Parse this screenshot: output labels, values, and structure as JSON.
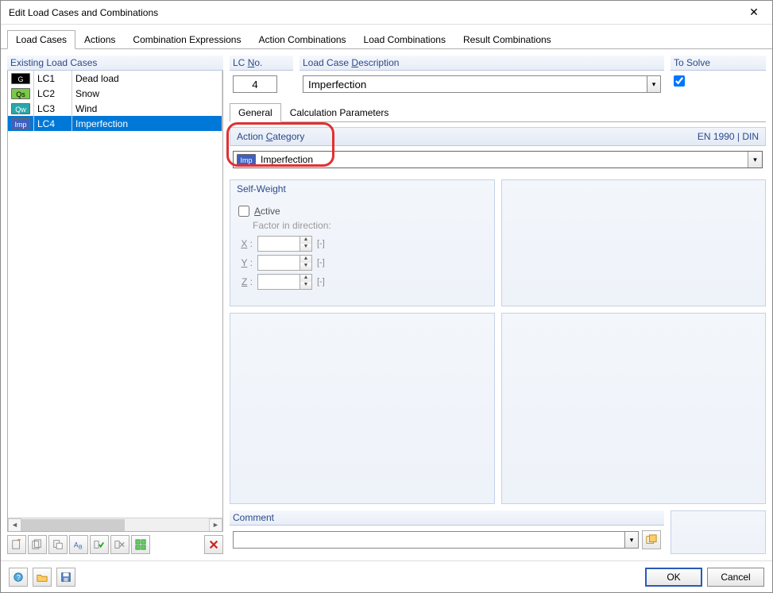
{
  "window": {
    "title": "Edit Load Cases and Combinations"
  },
  "mainTabs": [
    "Load Cases",
    "Actions",
    "Combination Expressions",
    "Action Combinations",
    "Load Combinations",
    "Result Combinations"
  ],
  "left": {
    "header": "Existing Load Cases",
    "rows": [
      {
        "tag": "G",
        "tagClass": "tag-g",
        "code": "LC1",
        "desc": "Dead load"
      },
      {
        "tag": "Qs",
        "tagClass": "tag-qs",
        "code": "LC2",
        "desc": "Snow"
      },
      {
        "tag": "Qw",
        "tagClass": "tag-qw",
        "code": "LC3",
        "desc": "Wind"
      },
      {
        "tag": "Imp",
        "tagClass": "tag-imp",
        "code": "LC4",
        "desc": "Imperfection"
      }
    ]
  },
  "lcNo": {
    "label_pre": "LC ",
    "label_u": "N",
    "label_post": "o.",
    "value": "4"
  },
  "desc": {
    "label_pre": "Load Case ",
    "label_u": "D",
    "label_post": "escription",
    "value": "Imperfection"
  },
  "solve": {
    "label": "To Solve",
    "checked": true
  },
  "subTabs": [
    "General",
    "Calculation Parameters"
  ],
  "actionCat": {
    "label_pre": "Action ",
    "label_u": "C",
    "label_post": "ategory",
    "std": "EN 1990 | DIN",
    "tag": "Imp",
    "text": "Imperfection"
  },
  "selfWeight": {
    "header": "Self-Weight",
    "active_u": "A",
    "active_post": "ctive",
    "factorLabel": "Factor in direction:",
    "axes": [
      {
        "u": "X",
        "post": " :",
        "val": ""
      },
      {
        "u": "Y",
        "post": " :",
        "val": ""
      },
      {
        "u": "Z",
        "post": " :",
        "val": ""
      }
    ],
    "unit": "[-]"
  },
  "comment": {
    "label": "Comment",
    "value": ""
  },
  "footer": {
    "ok": "OK",
    "cancel": "Cancel"
  }
}
